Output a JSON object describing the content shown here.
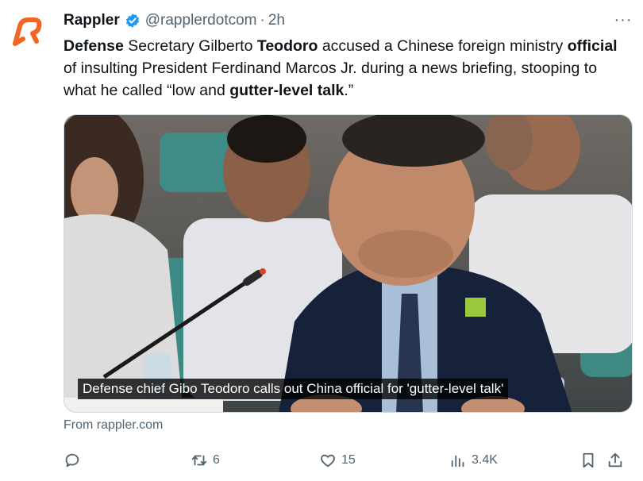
{
  "post": {
    "author_name": "Rappler",
    "handle": "@rapplerdotcom",
    "separator": "·",
    "time": "2h",
    "more_label": "···",
    "text": {
      "p1": "Defense",
      "p2": " Secretary Gilberto ",
      "p3": "Teodoro",
      "p4": " accused a Chinese foreign ministry ",
      "p5": "official",
      "p6": " of insulting President Ferdinand Marcos Jr. during a news briefing, stooping to what he called “low and ",
      "p7": "gutter-level talk",
      "p8": ".”"
    },
    "media_caption": "Defense chief Gibo Teodoro calls out China official for 'gutter-level talk'",
    "source": "From rappler.com",
    "actions": {
      "reply_count": "",
      "repost_count": "6",
      "like_count": "15",
      "view_count": "3.4K"
    }
  },
  "icons": {
    "avatar": "rappler-logo-icon",
    "verified": "verified-badge-icon",
    "reply": "reply-icon",
    "repost": "repost-icon",
    "like": "heart-icon",
    "views": "views-icon",
    "bookmark": "bookmark-icon",
    "share": "share-icon"
  },
  "colors": {
    "brand_orange": "#f26522",
    "verified_blue": "#1d9bf0",
    "muted_text": "#536471"
  }
}
